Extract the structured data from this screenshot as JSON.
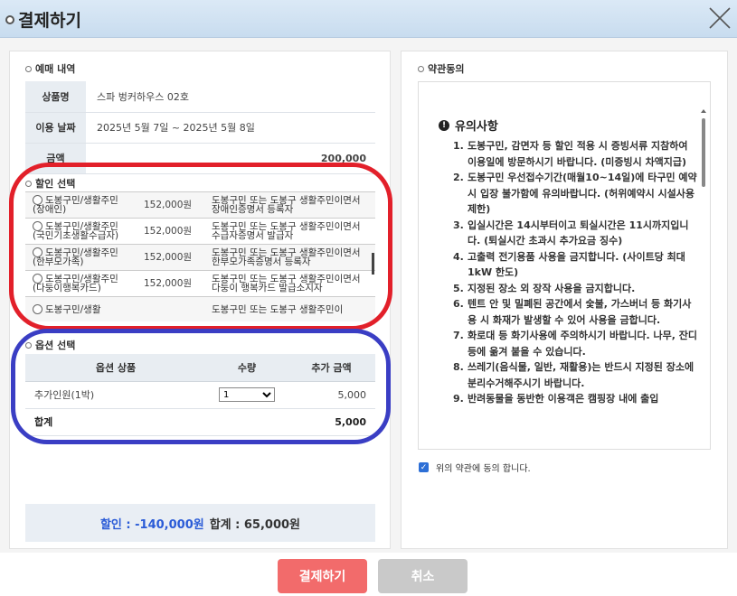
{
  "header": {
    "title": "결제하기"
  },
  "reservation": {
    "section_title": "예매 내역",
    "rows": [
      {
        "label": "상품명",
        "value": "스파 벙커하우스 02호"
      },
      {
        "label": "이용 날짜",
        "value": "2025년 5월 7일 ~ 2025년 5월 8일"
      },
      {
        "label": "금액",
        "value": "200,000"
      }
    ]
  },
  "discount": {
    "section_title": "할인 선택",
    "items": [
      {
        "name": "도봉구민/생활주민(장애인)",
        "price": "152,000원",
        "desc": "도봉구민 또는 도봉구 생활주민이면서 장애인증명서 등록자"
      },
      {
        "name": "도봉구민/생활주민(국민기초생활수급자)",
        "price": "152,000원",
        "desc": "도봉구민 또는 도봉구 생활주민이면서 수급자증명서 발급자"
      },
      {
        "name": "도봉구민/생활주민(한부모가족)",
        "price": "152,000원",
        "desc": "도봉구민 또는 도봉구 생활주민이면서 한부모가족증명서 등록자"
      },
      {
        "name": "도봉구민/생활주민(다둥이행복카드)",
        "price": "152,000원",
        "desc": "도봉구민 또는 도봉구 생활주민이면서 다둥이 행복카드 발급소지자"
      },
      {
        "name": "도봉구민/생활",
        "price": "",
        "desc": "도봉구민 또는 도봉구 생활주민이"
      }
    ]
  },
  "options": {
    "section_title": "옵션 선택",
    "headers": {
      "product": "옵션 상품",
      "qty": "수량",
      "extra": "추가 금액"
    },
    "rows": [
      {
        "product": "추가인원(1박)",
        "qty": "1",
        "extra": "5,000"
      }
    ],
    "total_label": "합계",
    "total_value": "5,000"
  },
  "summary": {
    "discount_text": "할인 : -140,000원",
    "total_text": "합계 : 65,000원"
  },
  "terms": {
    "section_title": "약관동의",
    "heading": "유의사항",
    "items": [
      {
        "num": "1.",
        "text": "도봉구민, 감면자 등 할인 적용 시 증빙서류 지참하여 이용일에 방문하시기 바랍니다. (미증빙시 차액지급)"
      },
      {
        "num": "2.",
        "text": "도봉구민 우선접수기간(매월10~14일)에 타구민 예약시 입장 불가함에 유의바랍니다. (허위예약시 시설사용 제한)"
      },
      {
        "num": "3.",
        "text": "입실시간은 14시부터이고 퇴실시간은 11시까지입니다. (퇴실시간 초과시 추가요금 징수)"
      },
      {
        "num": "4.",
        "text": "고출력 전기용품 사용을 금지합니다. (사이트당 최대 1kW 한도)"
      },
      {
        "num": "5.",
        "text": "지정된 장소 외 장작 사용을 금지합니다."
      },
      {
        "num": "6.",
        "text": "텐트 안 및 밀폐된 공간에서 숯불, 가스버너 등 화기사용 시 화재가 발생할 수 있어 사용을 금합니다."
      },
      {
        "num": "7.",
        "text": "화로대 등 화기사용에 주의하시기 바랍니다. 나무, 잔디 등에 옮겨 붙을 수 있습니다."
      },
      {
        "num": "8.",
        "text": "쓰레기(음식물, 일반, 재활용)는 반드시 지정된 장소에 분리수거해주시기 바랍니다."
      },
      {
        "num": "9.",
        "text": "반려동물을 동반한 이용객은 캠핑장 내에 출입"
      }
    ],
    "agree_label": "위의 약관에 동의 합니다."
  },
  "buttons": {
    "pay": "결제하기",
    "cancel": "취소"
  }
}
